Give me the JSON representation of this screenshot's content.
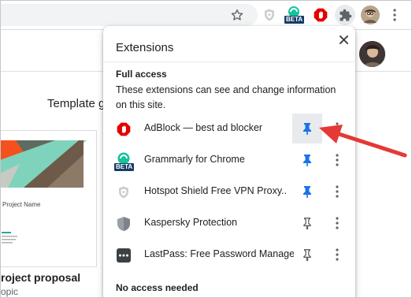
{
  "toolbar": {
    "icons": [
      "star-icon",
      "hotspot-shield-icon",
      "grammarly-beta-icon",
      "adblock-icon",
      "extensions-puzzle-icon",
      "profile-avatar",
      "more-icon"
    ],
    "beta_label": "BETA"
  },
  "page": {
    "template_heading": "Template g",
    "thumbnail_name": "Project Name",
    "card_title": "roject proposal",
    "card_subtitle": "opic"
  },
  "extensions_popup": {
    "title": "Extensions",
    "close_icon": "close-icon",
    "full_access": {
      "heading": "Full access",
      "description": "These extensions can see and change information on this site."
    },
    "items": [
      {
        "name": "AdBlock — best ad blocker",
        "icon": "adblock-icon",
        "pinned": true
      },
      {
        "name": "Grammarly for Chrome",
        "icon": "grammarly-icon",
        "pinned": true,
        "badge": "BETA"
      },
      {
        "name": "Hotspot Shield Free VPN Proxy...",
        "icon": "hotspot-shield-icon",
        "pinned": true
      },
      {
        "name": "Kaspersky Protection",
        "icon": "kaspersky-icon",
        "pinned": false
      },
      {
        "name": "LastPass: Free Password Manager",
        "icon": "lastpass-icon",
        "pinned": false
      }
    ],
    "no_access": {
      "heading": "No access needed"
    }
  },
  "colors": {
    "pin_active": "#1a73e8",
    "pin_inactive": "#5f6368",
    "adblock_red": "#e60000",
    "grammarly_green": "#15c39a",
    "annotation_red": "#e53935"
  }
}
